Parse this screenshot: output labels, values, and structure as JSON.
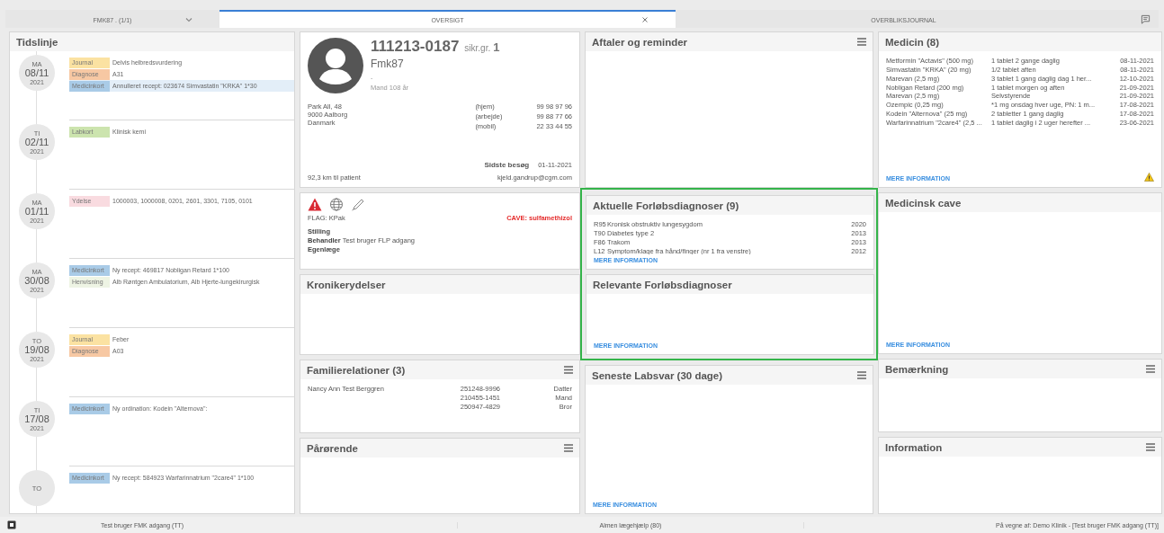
{
  "tabs": [
    {
      "label": "FMK87 . (1/1)",
      "selected": false,
      "kind": "dropdown"
    },
    {
      "label": "OVERSIGT",
      "selected": true,
      "kind": "closable"
    },
    {
      "label": "OVERBLIKSJOURNAL",
      "selected": false,
      "kind": "plain"
    }
  ],
  "timeline": {
    "title": "Tidslinje",
    "days": [
      {
        "weekday": "MA",
        "date": "08/11",
        "year": "2021",
        "events": [
          {
            "tag": "Journal",
            "color": "#fbe2a2",
            "text": "Delvis helbredsvurdering",
            "highlighted": false
          },
          {
            "tag": "Diagnose",
            "color": "#f7c8a3",
            "text": "A31",
            "highlighted": false
          },
          {
            "tag": "Medicinkort",
            "color": "#a9cbe7",
            "text": "Annulleret recept: 023674 Simvastatin \"KRKA\" 1*30",
            "highlighted": true
          }
        ]
      },
      {
        "weekday": "TI",
        "date": "02/11",
        "year": "2021",
        "events": [
          {
            "tag": "Labkort",
            "color": "#cce4ae",
            "text": "Klinisk kemi",
            "highlighted": false
          }
        ]
      },
      {
        "weekday": "MA",
        "date": "01/11",
        "year": "2021",
        "events": [
          {
            "tag": "Ydelse",
            "color": "#f9dbe0",
            "text": "1000003, 1000008, 0201, 2601, 3301, 7105, 0101",
            "highlighted": false
          }
        ]
      },
      {
        "weekday": "MA",
        "date": "30/08",
        "year": "2021",
        "events": [
          {
            "tag": "Medicinkort",
            "color": "#a9cbe7",
            "text": "Ny recept: 469817 Nobligan Retard 1*100",
            "highlighted": false
          },
          {
            "tag": "Henvisning",
            "color": "#eef4e4",
            "text": "Alb Røntgen Ambulatorium, Alb Hjerte-lungekirurgisk",
            "highlighted": false
          }
        ]
      },
      {
        "weekday": "TO",
        "date": "19/08",
        "year": "2021",
        "events": [
          {
            "tag": "Journal",
            "color": "#fbe2a2",
            "text": "Feber",
            "highlighted": false
          },
          {
            "tag": "Diagnose",
            "color": "#f7c8a3",
            "text": "A03",
            "highlighted": false
          }
        ]
      },
      {
        "weekday": "TI",
        "date": "17/08",
        "year": "2021",
        "events": [
          {
            "tag": "Medicinkort",
            "color": "#a9cbe7",
            "text": "Ny ordination: Kodein \"Alternova\":",
            "highlighted": false
          }
        ]
      },
      {
        "weekday": "TO",
        "events": [
          {
            "tag": "Medicinkort",
            "color": "#a9cbe7",
            "text": "Ny recept: 584923 Warfarinnatrium \"2care4\" 1*100",
            "highlighted": false
          }
        ]
      }
    ]
  },
  "columns": [
    {
      "panels": [
        {
          "kind": "patient",
          "cpr": "111213-0187",
          "insurance_label": "sikr.gr.",
          "insurance_group": "1",
          "name": "Fmk87",
          "line": ".",
          "gender_age": "Mand 108 år",
          "address": [
            "Park All, 48",
            "9000 Aalborg",
            "Danmark"
          ],
          "phones": [
            {
              "label": "(hjem)",
              "number": "99 98 97 96"
            },
            {
              "label": "(arbejde)",
              "number": "99 88 77 66"
            },
            {
              "label": "(mobil)",
              "number": "22 33 44 55"
            }
          ],
          "last_visit_label": "Sidste besøg",
          "last_visit": "01-11-2021",
          "distance": "92,3 km til patient",
          "email": "kjeld.gandrup@cgm.com"
        },
        {
          "kind": "flags",
          "flag": "FLAG: KPak",
          "cave": "CAVE: sulfamethizol",
          "lines": [
            "**Stilling**",
            "**Behandler** Test bruger FLP adgang",
            "**Egenlæge**"
          ]
        },
        {
          "kind": "empty",
          "title": "Kronikerydelser",
          "menu": false,
          "highlighted": false
        },
        {
          "kind": "family",
          "title": "Familierelationer (3)",
          "menu": true,
          "highlighted": false,
          "name": "Nancy Ann Test Berggren",
          "relations": [
            {
              "cpr": "251248-9996",
              "relation": "Datter"
            },
            {
              "cpr": "210455-1451",
              "relation": "Mand"
            },
            {
              "cpr": "250947-4829",
              "relation": "Bror"
            }
          ]
        },
        {
          "kind": "empty",
          "title": "Pårørende",
          "menu": true,
          "highlighted": false
        }
      ]
    },
    {
      "panels": [
        {
          "kind": "empty",
          "title": "Aftaler og reminder",
          "menu": true,
          "highlighted": false
        },
        {
          "kind": "diagnoses",
          "title": "Aktuelle Forløbsdiagnoser (9)",
          "menu": false,
          "highlighted": true,
          "rows": [
            {
              "code": "R95",
              "text": "Kronisk obstruktiv lungesygdom",
              "year": "2020"
            },
            {
              "code": "T90",
              "text": "Diabetes type 2",
              "year": "2013"
            },
            {
              "code": "F86",
              "text": "Trakom",
              "year": "2013"
            },
            {
              "code": "L12",
              "text": "Symptom/klage fra hånd/finger (nr 1 fra venstre)",
              "year": "2012"
            }
          ],
          "more": "MERE INFORMATION"
        },
        {
          "kind": "empty",
          "title": "Relevante Forløbsdiagnoser",
          "menu": false,
          "highlighted": true,
          "more": "MERE INFORMATION"
        },
        {
          "kind": "empty",
          "title": "Seneste Labsvar (30 dage)",
          "menu": true,
          "highlighted": false,
          "more": "MERE INFORMATION"
        }
      ]
    },
    {
      "panels": [
        {
          "kind": "medicine",
          "title": "Medicin (8)",
          "menu": false,
          "highlighted": false,
          "rows": [
            {
              "name": "Metformin \"Actavis\" (500 mg)",
              "dose": "1 tablet 2 gange daglig",
              "date": "08-11-2021"
            },
            {
              "name": "Simvastatin \"KRKA\" (20 mg)",
              "dose": "1/2 tablet aften",
              "date": "08-11-2021"
            },
            {
              "name": "Marevan (2,5 mg)",
              "dose": "3 tablet 1 gang daglig dag 1 her...",
              "date": "12-10-2021"
            },
            {
              "name": "Nobligan Retard (200 mg)",
              "dose": "1 tablet morgen og aften",
              "date": "21-09-2021"
            },
            {
              "name": "Marevan (2,5 mg)",
              "dose": "Selvstyrende",
              "date": "21-09-2021"
            },
            {
              "name": "Ozempic (0,25 mg)",
              "dose": "*1 mg onsdag hver uge, PN: 1 m...",
              "date": "17-08-2021"
            },
            {
              "name": "Kodein \"Alternova\" (25 mg)",
              "dose": "2 tabletter 1 gang daglig",
              "date": "17-08-2021"
            },
            {
              "name": "Warfarinnatrium \"2care4\" (2,5 ...",
              "dose": "1 tablet daglig i 2 uger herefter ...",
              "date": "23-06-2021"
            }
          ],
          "more": "MERE INFORMATION",
          "warning": true
        },
        {
          "kind": "empty",
          "title": "Medicinsk cave",
          "menu": false,
          "highlighted": false,
          "more": "MERE INFORMATION"
        },
        {
          "kind": "empty",
          "title": "Bemærkning",
          "menu": true,
          "highlighted": false
        },
        {
          "kind": "empty",
          "title": "Information",
          "menu": true,
          "highlighted": false
        }
      ]
    }
  ],
  "status_bar": {
    "user": "Test bruger FMK adgang (TT)",
    "service": "Almen lægehjælp (80)",
    "on_behalf": "På vegne af: Demo Klinik - [Test bruger FMK adgang (TT)]"
  }
}
